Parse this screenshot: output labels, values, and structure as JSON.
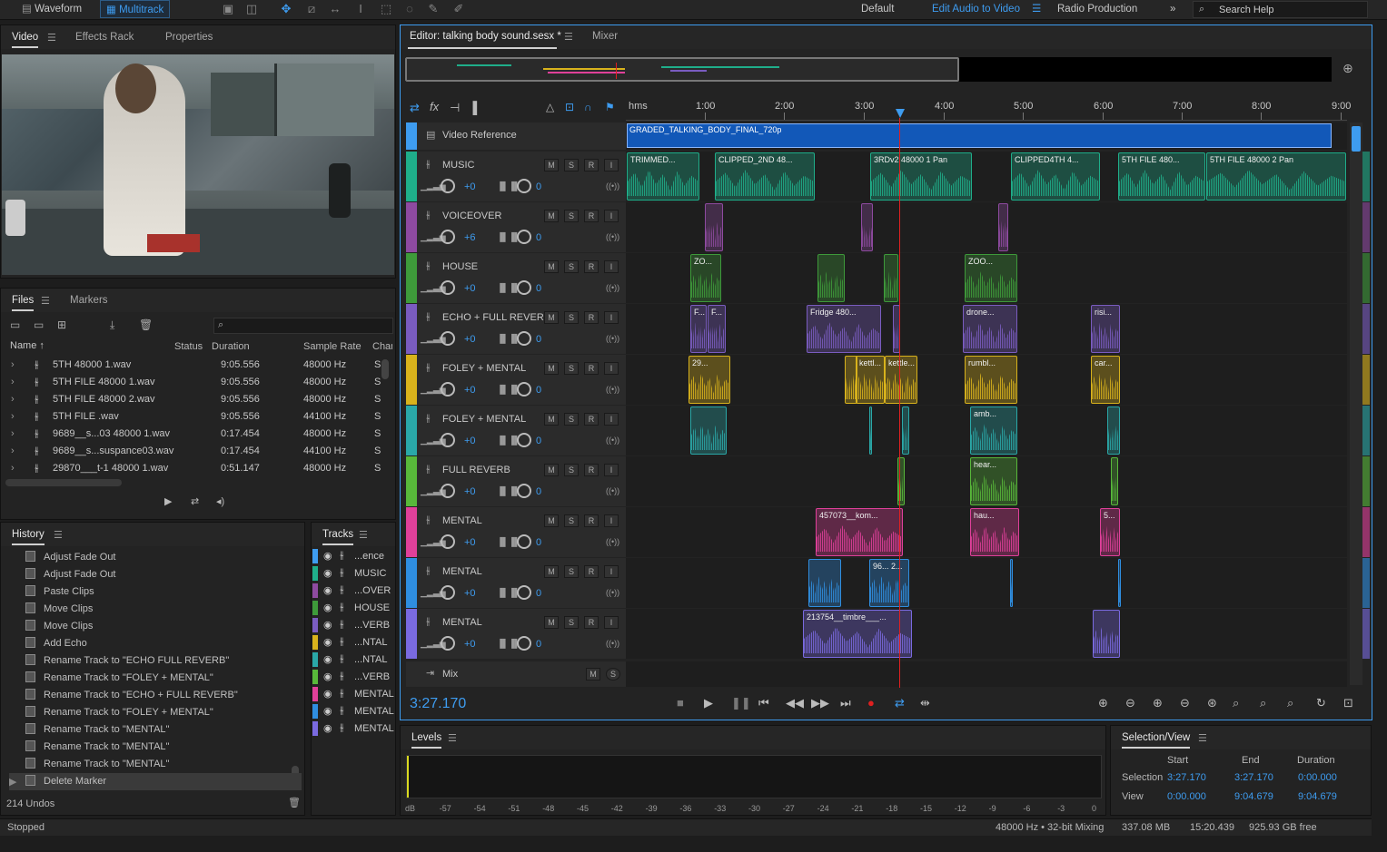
{
  "topbar": {
    "waveform": "Waveform",
    "multitrack": "Multitrack",
    "workspaces": [
      "Default",
      "Edit Audio to Video",
      "Radio Production"
    ],
    "more": "»",
    "search_placeholder": "Search Help"
  },
  "video_panel": {
    "tabs": [
      "Video",
      "Effects Rack",
      "Properties"
    ]
  },
  "files_panel": {
    "tabs": [
      "Files",
      "Markers"
    ],
    "columns": [
      "Name",
      "Status",
      "Duration",
      "Sample Rate",
      "Chan"
    ],
    "rows": [
      {
        "name": "5TH 48000 1.wav",
        "duration": "9:05.556",
        "rate": "48000 Hz",
        "ch": "S"
      },
      {
        "name": "5TH FILE  48000 1.wav",
        "duration": "9:05.556",
        "rate": "48000 Hz",
        "ch": "S"
      },
      {
        "name": "5TH FILE  48000 2.wav",
        "duration": "9:05.556",
        "rate": "48000 Hz",
        "ch": "S"
      },
      {
        "name": "5TH FILE .wav",
        "duration": "9:05.556",
        "rate": "44100 Hz",
        "ch": "S"
      },
      {
        "name": "9689__s...03 48000 1.wav",
        "duration": "0:17.454",
        "rate": "48000 Hz",
        "ch": "S"
      },
      {
        "name": "9689__s...suspance03.wav",
        "duration": "0:17.454",
        "rate": "44100 Hz",
        "ch": "S"
      },
      {
        "name": "29870___t-1 48000 1.wav",
        "duration": "0:51.147",
        "rate": "48000 Hz",
        "ch": "S"
      }
    ]
  },
  "history_panel": {
    "title": "History",
    "items": [
      "Adjust Fade Out",
      "Adjust Fade Out",
      "Paste Clips",
      "Move Clips",
      "Move Clips",
      "Add Echo",
      "Rename Track to \"ECHO FULL REVERB\"",
      "Rename Track to \"FOLEY + MENTAL\"",
      "Rename Track to \"ECHO + FULL REVERB\"",
      "Rename Track to \"FOLEY + MENTAL\"",
      "Rename Track to \"MENTAL\"",
      "Rename Track to \"MENTAL\"",
      "Rename Track to \"MENTAL\"",
      "Delete Marker"
    ],
    "undos": "214 Undos"
  },
  "tracks_panel": {
    "title": "Tracks",
    "items": [
      "...ence",
      "MUSIC",
      "...OVER",
      "HOUSE",
      "...VERB",
      "...NTAL",
      "...NTAL",
      "...VERB",
      "MENTAL",
      "MENTAL",
      "MENTAL"
    ]
  },
  "editor": {
    "tab": "Editor: talking body sound.sesx *",
    "mixer": "Mixer",
    "ruler": [
      "hms",
      "1:00",
      "2:00",
      "3:00",
      "4:00",
      "5:00",
      "6:00",
      "7:00",
      "8:00",
      "9:00"
    ],
    "video_track": {
      "name": "Video Reference",
      "clip": "GRADED_TALKING_BODY_FINAL_720p"
    },
    "tracks": [
      {
        "name": "MUSIC",
        "vol": "+0",
        "pan": "0",
        "color": "#1fae8a"
      },
      {
        "name": "VOICEOVER",
        "vol": "+6",
        "pan": "0",
        "color": "#8e4aa0"
      },
      {
        "name": "HOUSE",
        "vol": "+0",
        "pan": "0",
        "color": "#3e9a3a"
      },
      {
        "name": "ECHO + FULL REVER",
        "vol": "+0",
        "pan": "0",
        "color": "#7a5cc0"
      },
      {
        "name": "FOLEY + MENTAL",
        "vol": "+0",
        "pan": "0",
        "color": "#d8b21c"
      },
      {
        "name": "FOLEY + MENTAL",
        "vol": "+0",
        "pan": "0",
        "color": "#2aa8a8"
      },
      {
        "name": "FULL REVERB",
        "vol": "+0",
        "pan": "0",
        "color": "#58b83a"
      },
      {
        "name": "MENTAL",
        "vol": "+0",
        "pan": "0",
        "color": "#e0409a"
      },
      {
        "name": "MENTAL",
        "vol": "+0",
        "pan": "0",
        "color": "#2f8ee0"
      },
      {
        "name": "MENTAL",
        "vol": "+0",
        "pan": "0",
        "color": "#7a6ae0"
      }
    ],
    "clips": [
      [
        [
          "TRIMMED...",
          690,
          80
        ],
        [
          "CLIPPED_2ND 48...",
          787,
          110
        ],
        [
          "3RDv2 48000 1   Pan",
          958,
          112
        ],
        [
          "CLIPPED4TH 4...",
          1113,
          98
        ],
        [
          "5TH FILE  480...",
          1231,
          96
        ],
        [
          "5TH FILE  48000 2          Pan",
          1328,
          154
        ]
      ],
      [
        [
          "",
          776,
          20
        ],
        [
          "",
          948,
          13
        ],
        [
          "",
          1099,
          11
        ]
      ],
      [
        [
          "ZO...",
          760,
          34
        ],
        [
          "",
          900,
          30
        ],
        [
          "",
          973,
          16
        ],
        [
          "ZOO...",
          1062,
          58
        ]
      ],
      [
        [
          "F...",
          760,
          18
        ],
        [
          "F...",
          779,
          20
        ],
        [
          "Fridge 480...",
          888,
          82
        ],
        [
          "",
          983,
          8
        ],
        [
          "drone...",
          1060,
          60
        ],
        [
          "risi...",
          1201,
          32
        ]
      ],
      [
        [
          "29...",
          758,
          46
        ],
        [
          "",
          930,
          14
        ],
        [
          "kettl...",
          942,
          32
        ],
        [
          "kettle...",
          974,
          36
        ],
        [
          "rumbl...",
          1062,
          58
        ],
        [
          "car...",
          1201,
          32
        ]
      ],
      [
        [
          "",
          760,
          40
        ],
        [
          "",
          957,
          3
        ],
        [
          "",
          993,
          8
        ],
        [
          "amb...",
          1068,
          52
        ],
        [
          "",
          1219,
          14
        ]
      ],
      [
        [
          "",
          988,
          8
        ],
        [
          "hear...",
          1068,
          52
        ],
        [
          "",
          1223,
          8
        ]
      ],
      [
        [
          "457073__kom...",
          898,
          96
        ],
        [
          "hau...",
          1068,
          54
        ],
        [
          "5...",
          1211,
          22
        ]
      ],
      [
        [
          "",
          890,
          36
        ],
        [
          "96...   2...",
          957,
          44
        ],
        [
          "",
          1112,
          3
        ],
        [
          "",
          1231,
          3
        ]
      ],
      [
        [
          "213754__timbre___...",
          884,
          120
        ],
        [
          "",
          1203,
          30
        ]
      ]
    ],
    "mix_label": "Mix",
    "time": "3:27.170"
  },
  "levels": {
    "title": "Levels",
    "ticks": [
      "dB",
      "-57",
      "-54",
      "-51",
      "-48",
      "-45",
      "-42",
      "-39",
      "-36",
      "-33",
      "-30",
      "-27",
      "-24",
      "-21",
      "-18",
      "-15",
      "-12",
      "-9",
      "-6",
      "-3",
      "0"
    ]
  },
  "selection_view": {
    "title": "Selection/View",
    "headers": [
      "Start",
      "End",
      "Duration"
    ],
    "selection_label": "Selection",
    "view_label": "View",
    "selection": [
      "3:27.170",
      "3:27.170",
      "0:00.000"
    ],
    "view": [
      "0:00.000",
      "9:04.679",
      "9:04.679"
    ]
  },
  "status": {
    "left": "Stopped",
    "mix": "48000 Hz • 32-bit Mixing",
    "mem": "337.08 MB",
    "dur": "15:20.439",
    "free": "925.93 GB free"
  }
}
